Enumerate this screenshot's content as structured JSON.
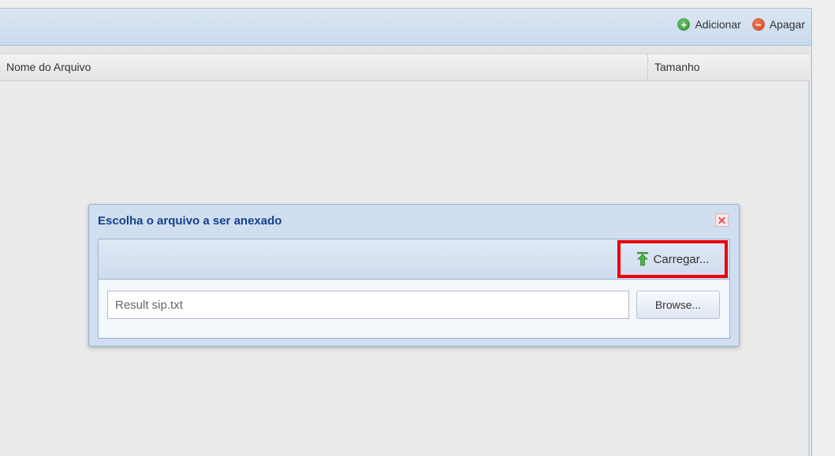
{
  "toolbar": {
    "add_label": "Adicionar",
    "delete_label": "Apagar"
  },
  "grid": {
    "columns": [
      "Nome do Arquivo",
      "Tamanho"
    ]
  },
  "dialog": {
    "title": "Escolha o arquivo a ser anexado",
    "close_symbol": "✕",
    "upload_label": "Carregar...",
    "file_value": "Result sip.txt",
    "browse_label": "Browse..."
  },
  "colors": {
    "title_blue": "#15428b",
    "highlight_red": "#e8000c",
    "add_green": "#2e8b2e",
    "delete_red": "#c8401f"
  },
  "icons": {
    "add": "plus-circle-icon",
    "delete": "minus-circle-icon",
    "upload": "upload-arrow-icon",
    "close": "close-icon"
  }
}
